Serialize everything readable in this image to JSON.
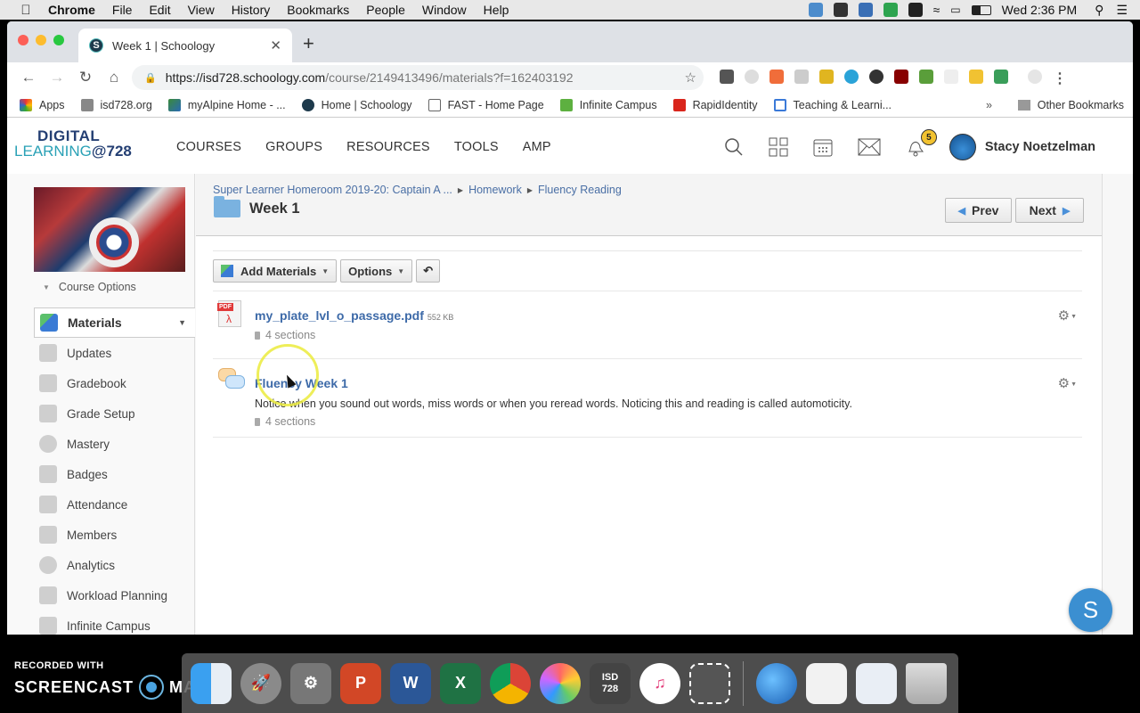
{
  "menubar": {
    "app": "Chrome",
    "items": [
      "File",
      "Edit",
      "View",
      "History",
      "Bookmarks",
      "People",
      "Window",
      "Help"
    ],
    "clock": "Wed 2:36 PM"
  },
  "browser": {
    "tab_title": "Week 1 | Schoology",
    "tab_favicon": "S",
    "url_host": "https://isd728.schoology.com",
    "url_path": "/course/2149413496/materials?f=162403192",
    "bookmarks": [
      {
        "label": "Apps",
        "icon": "apps-grid-icon"
      },
      {
        "label": "isd728.org",
        "icon": "folder-icon"
      },
      {
        "label": "myAlpine Home - ...",
        "icon": "alpine-icon"
      },
      {
        "label": "Home | Schoology",
        "icon": "schoology-icon"
      },
      {
        "label": "FAST - Home Page",
        "icon": "page-icon"
      },
      {
        "label": "Infinite Campus",
        "icon": "infinite-campus-icon"
      },
      {
        "label": "RapidIdentity",
        "icon": "rapididentity-icon"
      },
      {
        "label": "Teaching & Learni...",
        "icon": "doc-icon"
      }
    ],
    "bookmarks_more": "»",
    "other_bookmarks": "Other Bookmarks"
  },
  "header": {
    "logo_line1": "DIGITAL",
    "logo_line2": "LEARNING",
    "logo_line2_suffix": "@728",
    "nav": [
      "COURSES",
      "GROUPS",
      "RESOURCES",
      "TOOLS",
      "AMP"
    ],
    "notifications_count": "5",
    "user_name": "Stacy Noetzelman"
  },
  "sidebar": {
    "course_options": "Course Options",
    "items": [
      {
        "label": "Materials",
        "active": true
      },
      {
        "label": "Updates"
      },
      {
        "label": "Gradebook"
      },
      {
        "label": "Grade Setup"
      },
      {
        "label": "Mastery"
      },
      {
        "label": "Badges"
      },
      {
        "label": "Attendance"
      },
      {
        "label": "Members"
      },
      {
        "label": "Analytics"
      },
      {
        "label": "Workload Planning"
      },
      {
        "label": "Infinite Campus"
      }
    ]
  },
  "main": {
    "breadcrumb": [
      "Super Learner Homeroom 2019-20: Captain A ...",
      "Homework",
      "Fluency Reading"
    ],
    "title": "Week 1",
    "prev_label": "Prev",
    "next_label": "Next",
    "add_materials_label": "Add Materials",
    "options_label": "Options",
    "materials": [
      {
        "type": "pdf",
        "name": "my_plate_lvl_o_passage.pdf",
        "size": "552 KB",
        "sections": "4 sections"
      },
      {
        "type": "discussion",
        "name": "Fluency Week 1",
        "description": "Notice when you sound out words, miss words or when you reread words. Noticing this and reading is called automoticity.",
        "sections": "4 sections"
      }
    ]
  },
  "fab_label": "S",
  "watermark": {
    "line1": "RECORDED WITH",
    "line2a": "SCREENCAST",
    "line2b": "MATIC"
  },
  "dock": [
    "Finder",
    "Launchpad",
    "System Preferences",
    "PowerPoint",
    "Word",
    "Excel",
    "Chrome",
    "Photos",
    "Self Service (jamf)",
    "iTunes",
    "Screenshot",
    "Network",
    "Preview",
    "Chrome App",
    "Trash"
  ]
}
